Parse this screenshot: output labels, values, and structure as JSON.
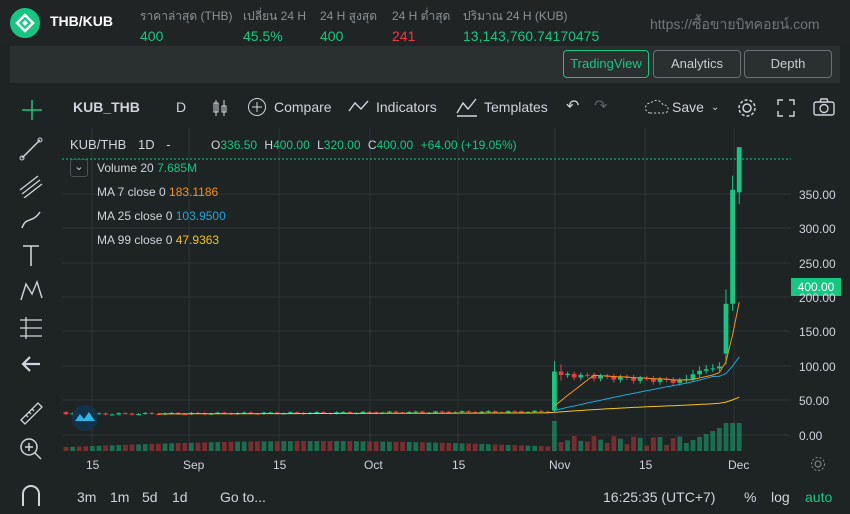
{
  "header": {
    "pair": "THB/KUB",
    "stats": [
      {
        "label": "ราคาล่าสุด (THB)",
        "value": "400",
        "color": "green"
      },
      {
        "label": "เปลี่ยน 24 H",
        "value": "45.5%",
        "color": "green"
      },
      {
        "label": "24 H สูงสุด",
        "value": "400",
        "color": "green"
      },
      {
        "label": "24 H ต่ำสุด",
        "value": "241",
        "color": "red"
      },
      {
        "label": "ปริมาณ 24 H (KUB)",
        "value": "13,143,760.74170475",
        "color": "green"
      }
    ],
    "watermark": "https://ซื้อขายบิทคอยน์.com"
  },
  "view_tabs": {
    "trading_view": "TradingView",
    "analytics": "Analytics",
    "depth": "Depth"
  },
  "toolbar": {
    "symbol": "KUB_THB",
    "interval": "D",
    "compare": "Compare",
    "indicators": "Indicators",
    "templates": "Templates",
    "save": "Save"
  },
  "legend": {
    "symbol": "KUB/THB",
    "interval": "1D",
    "dash": "-",
    "o_label": "O",
    "o": "336.50",
    "h_label": "H",
    "h": "400.00",
    "l_label": "L",
    "l": "320.00",
    "c_label": "C",
    "c": "400.00",
    "change": "+64.00 (+19.05%)",
    "volume_label": "Volume 20",
    "volume": "7.685M",
    "ma7_label": "MA 7 close 0",
    "ma7": "183.1186",
    "ma25_label": "MA 25 close 0",
    "ma25": "103.9500",
    "ma99_label": "MA 99 close 0",
    "ma99": "47.9363"
  },
  "colors": {
    "up": "#16c784",
    "down": "#ea3943",
    "ma7": "#f7931a",
    "ma25": "#1ea7d8",
    "ma99": "#f0c419",
    "accent": "#16c784"
  },
  "price_axis": {
    "current": "400.00",
    "labels": [
      "350.00",
      "300.00",
      "250.00",
      "200.00",
      "150.00",
      "100.00",
      "50.00",
      "0.00"
    ]
  },
  "time_axis": {
    "labels": [
      "15",
      "Sep",
      "15",
      "Oct",
      "15",
      "Nov",
      "15",
      "Dec"
    ]
  },
  "bottom": {
    "ranges": [
      "3m",
      "1m",
      "5d",
      "1d"
    ],
    "goto": "Go to...",
    "time": "16:25:35 (UTC+7)",
    "percent": "%",
    "log": "log",
    "auto": "auto"
  },
  "chart_data": {
    "type": "candlestick",
    "title": "KUB/THB 1D",
    "ylim": [
      0,
      410
    ],
    "x_start_index": 0,
    "x_count": 110,
    "ohlc_tail": [
      {
        "i": 74,
        "o": 30,
        "h": 100,
        "l": 28,
        "c": 85
      },
      {
        "i": 75,
        "o": 85,
        "h": 95,
        "l": 72,
        "c": 80
      },
      {
        "i": 100,
        "o": 110,
        "h": 200,
        "l": 95,
        "c": 180
      },
      {
        "i": 101,
        "o": 180,
        "h": 360,
        "l": 170,
        "c": 340
      },
      {
        "i": 102,
        "o": 336.5,
        "h": 400,
        "l": 320,
        "c": 400
      }
    ],
    "series": [
      {
        "name": "MA 7 close 0",
        "last": 183.1186
      },
      {
        "name": "MA 25 close 0",
        "last": 103.95
      },
      {
        "name": "MA 99 close 0",
        "last": 47.9363
      },
      {
        "name": "Volume 20",
        "last": "7.685M"
      }
    ]
  }
}
